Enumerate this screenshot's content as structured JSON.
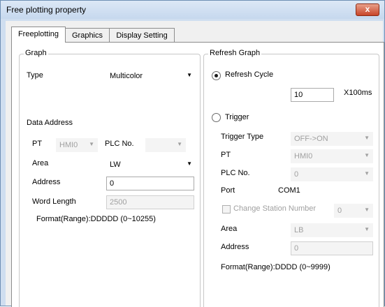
{
  "window": {
    "title": "Free plotting property",
    "close_glyph": "x"
  },
  "tabs": [
    {
      "label": "Freeplotting",
      "active": true
    },
    {
      "label": "Graphics",
      "active": false
    },
    {
      "label": "Display Setting",
      "active": false
    }
  ],
  "graph": {
    "group_title": "Graph",
    "type_label": "Type",
    "type_value": "Multicolor",
    "data_address_label": "Data Address",
    "pt_label": "PT",
    "pt_value": "HMI0",
    "plc_no_label": "PLC No.",
    "plc_no_value": "",
    "area_label": "Area",
    "area_value": "LW",
    "address_label": "Address",
    "address_value": "0",
    "word_length_label": "Word Length",
    "word_length_value": "2500",
    "format_text": "Format(Range):DDDDD (0~10255)"
  },
  "refresh": {
    "group_title": "Refresh Graph",
    "refresh_cycle_label": "Refresh Cycle",
    "refresh_cycle_selected": true,
    "cycle_value": "10",
    "cycle_unit": "X100ms",
    "trigger_label": "Trigger",
    "trigger_selected": false,
    "trigger_type_label": "Trigger Type",
    "trigger_type_value": "OFF->ON",
    "pt_label": "PT",
    "pt_value": "HMI0",
    "plc_no_label": "PLC No.",
    "plc_no_value": "0",
    "port_label": "Port",
    "port_value": "COM1",
    "change_station_label": "Change Station Number",
    "change_station_checked": false,
    "station_value": "0",
    "area_label": "Area",
    "area_value": "LB",
    "address_label": "Address",
    "address_value": "0",
    "format_text": "Format(Range):DDDD (0~9999)"
  },
  "icons": {
    "dropdown": "chevron-down-icon",
    "close": "close-icon"
  }
}
